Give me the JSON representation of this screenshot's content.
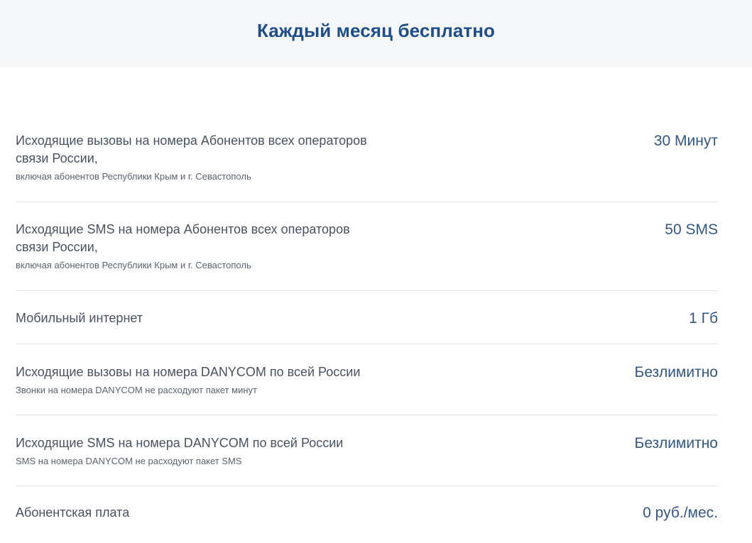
{
  "header": {
    "title": "Каждый месяц бесплатно"
  },
  "rows": [
    {
      "title": "Исходящие вызовы на номера Абонентов всех операторов связи России,",
      "subtitle": "включая абонентов Республики Крым и г. Севастополь",
      "value": "30 Минут"
    },
    {
      "title": "Исходящие SMS на номера Абонентов всех операторов связи России,",
      "subtitle": "включая абонентов Республики Крым и г. Севастополь",
      "value": "50 SMS"
    },
    {
      "title": "Мобильный интернет",
      "subtitle": "",
      "value": "1 Гб"
    },
    {
      "title": "Исходящие вызовы на номера DANYCOM по всей России",
      "subtitle": "Звонки на номера DANYCOM не расходуют пакет минут",
      "value": "Безлимитно"
    },
    {
      "title": "Исходящие SMS на номера DANYCOM по всей России",
      "subtitle": "SMS на номера DANYCOM не расходуют пакет SMS",
      "value": "Безлимитно"
    },
    {
      "title": "Абонентская плата",
      "subtitle": "",
      "value": "0 руб./мес."
    }
  ]
}
